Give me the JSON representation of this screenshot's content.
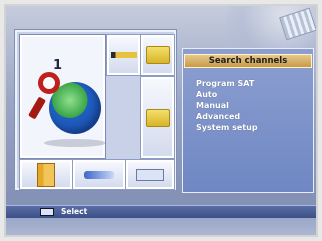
{
  "tile_grid": {
    "selected_number": "1",
    "icons": {
      "main": "globe-with-magnifier-icon",
      "top_mid": "pencil-icon",
      "top_right": "folder-icon",
      "mid_right": "folder-icon",
      "bottom_left": "book-icon",
      "bottom_mid": "tools-icon",
      "bottom_right": "keyboard-icon"
    }
  },
  "side_panel": {
    "title": "Search channels",
    "items": [
      {
        "label": "Program SAT"
      },
      {
        "label": "Auto"
      },
      {
        "label": "Manual"
      },
      {
        "label": "Advanced"
      },
      {
        "label": "System setup"
      }
    ]
  },
  "status_bar": {
    "select_label": "Select"
  },
  "colors": {
    "panel_bg": "#7b90c8",
    "title_bar": "#d5ad63",
    "status_bar": "#4b5f99"
  }
}
